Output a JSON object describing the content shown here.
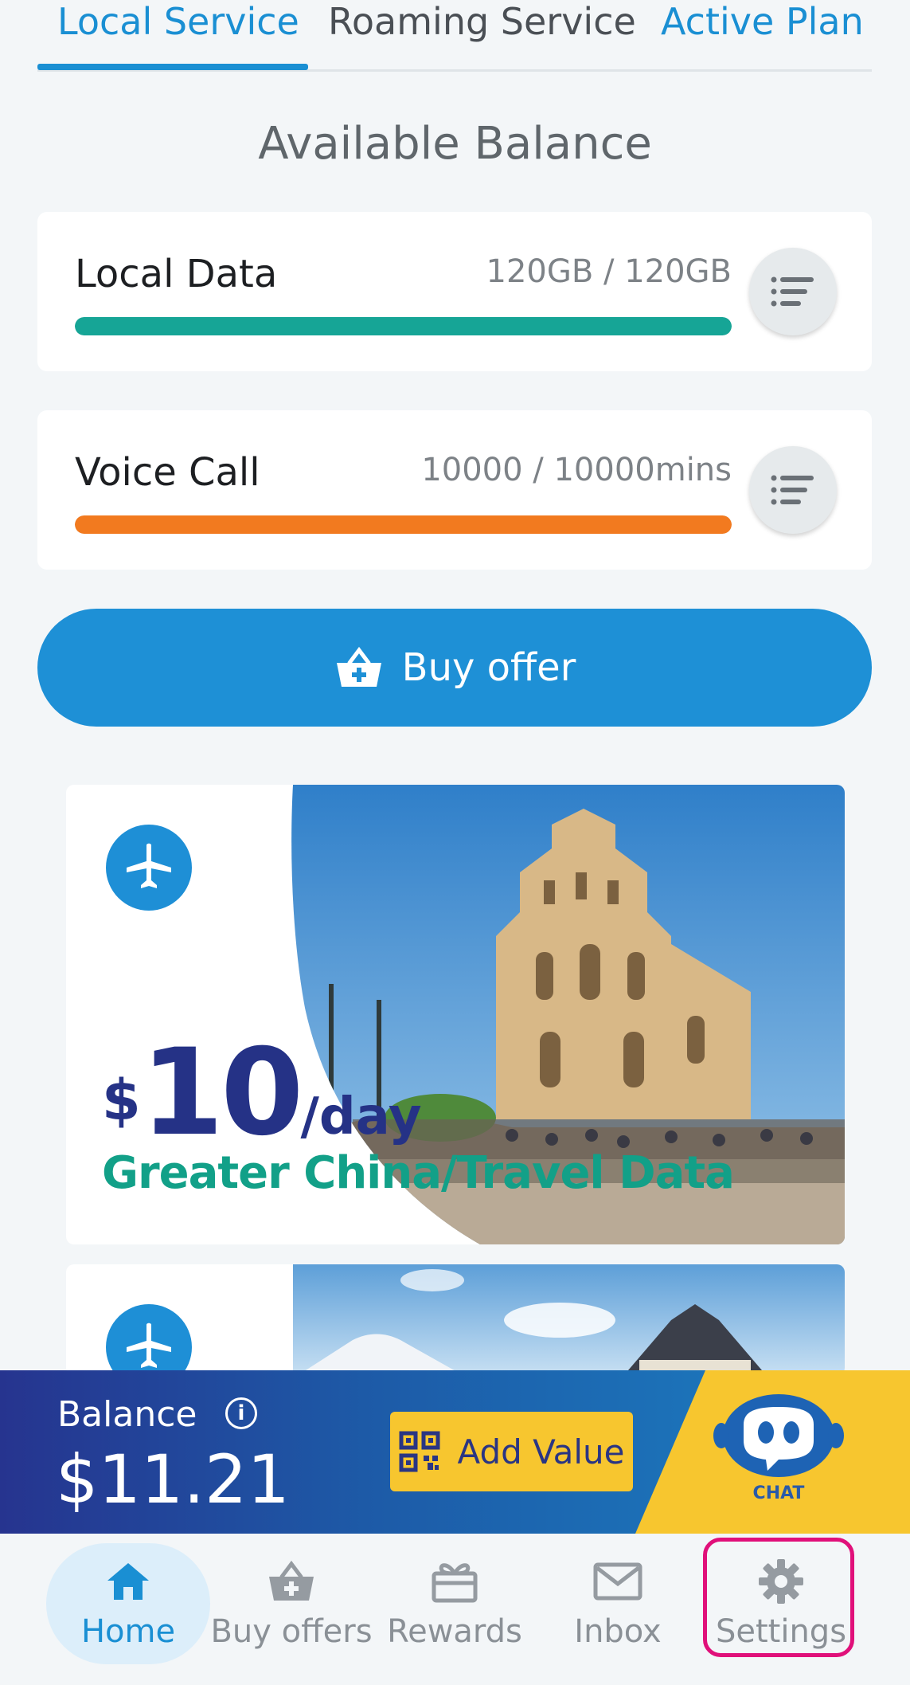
{
  "tabs": [
    {
      "label": "Local Service",
      "active": true
    },
    {
      "label": "Roaming Service",
      "active": false
    },
    {
      "label": "Active Plan",
      "active": false
    }
  ],
  "section_title": "Available Balance",
  "balances": [
    {
      "label": "Local Data",
      "value": "120GB / 120GB",
      "fraction": 1.0,
      "color": "#16a596"
    },
    {
      "label": "Voice Call",
      "value": "10000 / 10000mins",
      "fraction": 1.0,
      "color": "#f27a1f"
    }
  ],
  "buy_offer_label": "Buy offer",
  "promo": {
    "currency": "$",
    "amount": "10",
    "period": "/day",
    "subtitle": "Greater China/Travel Data",
    "colors": {
      "price": "#253286",
      "subtitle": "#12a088"
    }
  },
  "account": {
    "balance_label": "Balance",
    "balance_amount": "$11.21",
    "add_value_label": "Add Value",
    "chat_label": "CHAT"
  },
  "nav": [
    {
      "label": "Home",
      "icon": "home-icon",
      "active": true
    },
    {
      "label": "Buy offers",
      "icon": "basket-icon",
      "active": false
    },
    {
      "label": "Rewards",
      "icon": "gift-icon",
      "active": false
    },
    {
      "label": "Inbox",
      "icon": "mail-icon",
      "active": false
    },
    {
      "label": "Settings",
      "icon": "gear-icon",
      "active": false
    }
  ],
  "colors": {
    "accent": "#1a8fd3",
    "highlight": "#e0107a",
    "yellow": "#f7c62f"
  }
}
